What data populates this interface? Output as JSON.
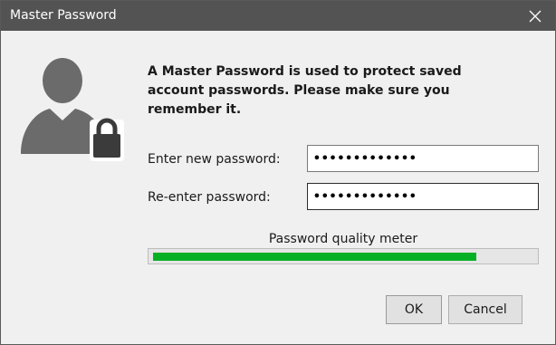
{
  "window": {
    "title": "Master Password",
    "close_icon": "close-icon"
  },
  "avatar_icon": "user-lock-icon",
  "message": "A Master Password is used to protect saved account passwords. Please make sure you remember it.",
  "fields": {
    "new_password": {
      "label": "Enter new password:",
      "value": "•••••••••••••"
    },
    "reenter_password": {
      "label": "Re-enter password:",
      "value": "•••••••••••••"
    }
  },
  "quality_meter": {
    "label": "Password quality meter",
    "level_fraction": 0.85,
    "color": "#06b025"
  },
  "buttons": {
    "ok": "OK",
    "cancel": "Cancel"
  },
  "colors": {
    "titlebar": "#535353",
    "dialog_background": "#f0f0f0",
    "avatar": "#6b6b6b"
  }
}
